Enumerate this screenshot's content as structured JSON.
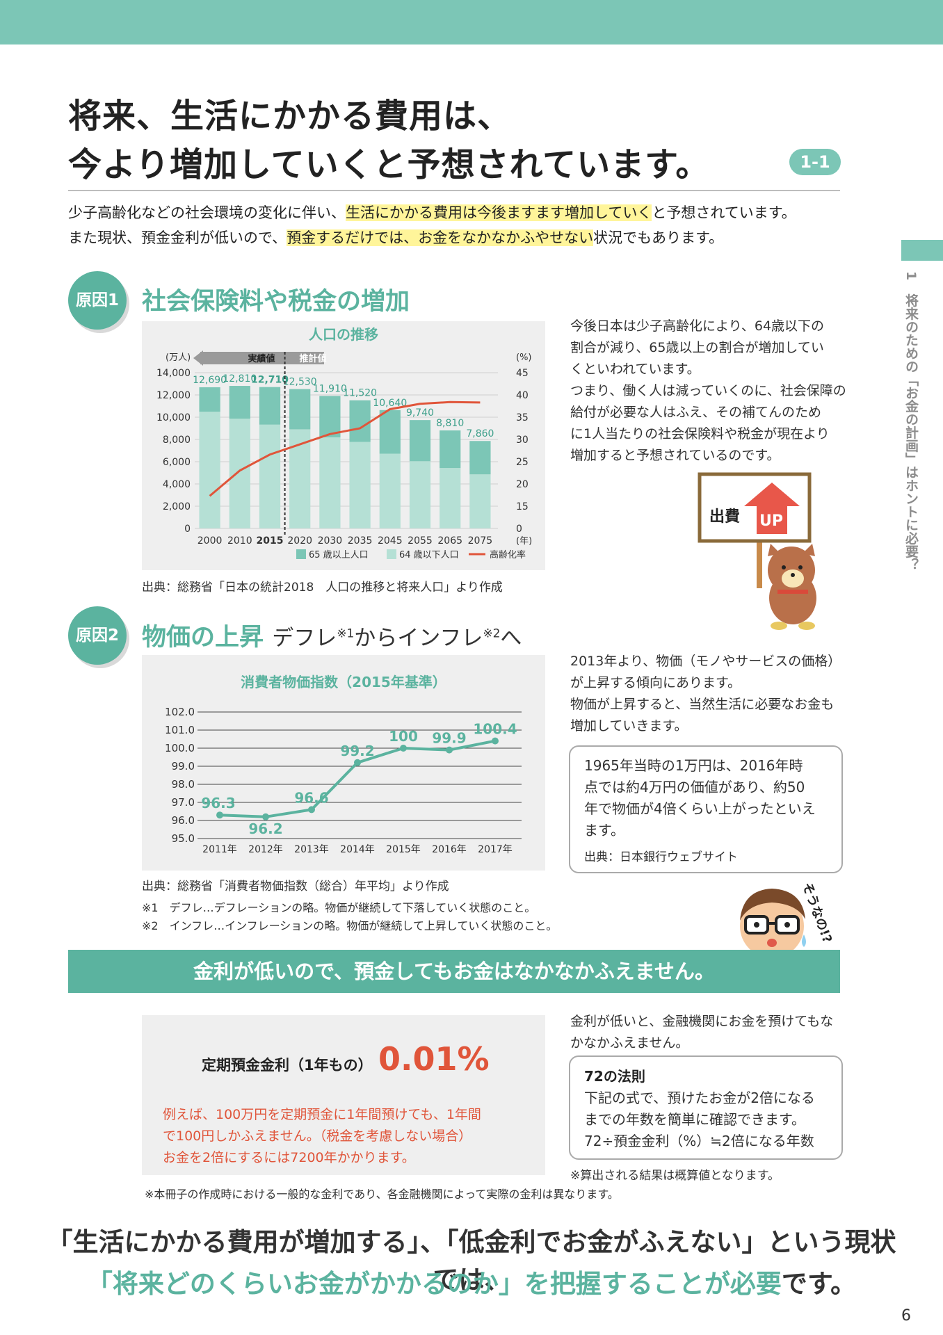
{
  "header": {
    "title_line1": "将来、生活にかかる費用は、",
    "title_line2": "今より増加していくと予想されています。",
    "badge": "1-1"
  },
  "side_tab": {
    "number": "1",
    "label": "将来のための「お金の計画」はホントに必要？"
  },
  "intro": {
    "l1a": "少子高齢化などの社会環境の変化に伴い、",
    "l1b": "生活にかかる費用は今後ますます増加していく",
    "l1c": "と予想されています。",
    "l2a": "また現状、預金金利が低いので、",
    "l2b": "預金するだけでは、お金をなかなかふやせない",
    "l2c": "状況でもあります。"
  },
  "cause1": {
    "badge": "原因1",
    "title": "社会保険料や税金の増加",
    "para": [
      "今後日本は少子高齢化により、64歳以下の",
      "割合が減り、65歳以上の割合が増加してい",
      "くといわれています。",
      "つまり、働く人は減っていくのに、社会保障の",
      "給付が必要な人はふえ、その補てんのため",
      "に1人当たりの社会保険料や税金が現在より",
      "増加すると予想されているのです。"
    ],
    "sign_text": "出費",
    "sign_up": "UP",
    "source": "出典：総務省「日本の統計2018　人口の推移と将来人口」より作成"
  },
  "cause2": {
    "badge": "原因2",
    "title": "物価の上昇",
    "subtitle_a": "デフレ",
    "subtitle_sup1": "※1",
    "subtitle_b": "からインフレ",
    "subtitle_sup2": "※2",
    "subtitle_c": "へ",
    "para": [
      "2013年より、物価（モノやサービスの価格）",
      "が上昇する傾向にあります。",
      "物価が上昇すると、当然生活に必要なお金も",
      "増加していきます。"
    ],
    "box": [
      "1965年当時の1万円は、2016年時",
      "点では約4万円の価値があり、約50",
      "年で物価が4倍くらい上がったといえ",
      "ます。"
    ],
    "box_source": "出典：日本銀行ウェブサイト",
    "source": "出典：総務省「消費者物価指数（総合）年平均」より作成",
    "note1": "※1　デフレ…デフレーションの略。物価が継続して下落していく状態のこと。",
    "note2": "※2　インフレ…インフレーションの略。物価が継続して上昇していく状態のこと。",
    "speech": "そうなの!?"
  },
  "banner": "金利が低いので、預金してもお金はなかなかふえません。",
  "rate": {
    "label": "定期預金金利（1年もの）",
    "value": "0.01%",
    "example": [
      "例えば、100万円を定期預金に1年間預けても、1年間",
      "で100円しかふえません。（税金を考慮しない場合）",
      "お金を2倍にするには7200年かかります。"
    ],
    "footnote": "※本冊子の作成時における一般的な金利であり、各金融機関によって実際の金利は異なります。",
    "right_para": [
      "金利が低いと、金融機関にお金を預けてもな",
      "かなかふえません。"
    ],
    "rule_title": "72の法則",
    "rule_lines": [
      "下記の式で、預けたお金が2倍になる",
      "までの年数を簡単に確認できます。",
      "72÷預金金利（%）≒2倍になる年数"
    ],
    "rule_note": "※算出される結果は概算値となります。"
  },
  "conclusion": {
    "line1": "「生活にかかる費用が増加する」、「低金利でお金がふえない」という現状では、",
    "line2a": "「将来どのくらいお金がかかるのか」を把握することが必要",
    "line2b": "です。"
  },
  "page_number": "6",
  "colors": {
    "teal": "#7cc6b6",
    "teal_dark": "#5bb39f",
    "bar_light": "#b5e0d5",
    "line_red": "#e0553a",
    "highlight": "#fff59a"
  },
  "chart_data": [
    {
      "type": "bar",
      "title": "人口の推移",
      "ylabel_left": "(万人)",
      "ylabel_right": "(%)",
      "xlabel": "(年)",
      "header_actual": "実績値",
      "header_forecast": "推計値",
      "categories": [
        "2000",
        "2010",
        "2015",
        "2020",
        "2030",
        "2035",
        "2045",
        "2055",
        "2065",
        "2075"
      ],
      "totals": [
        "12,690",
        "12,810",
        "12,710",
        "12,530",
        "11,910",
        "11,520",
        "10,640",
        "9,740",
        "8,810",
        "7,860"
      ],
      "series": [
        {
          "name": "65 歳以上人口",
          "values": [
            2200,
            2950,
            3380,
            3620,
            3720,
            3740,
            3920,
            3700,
            3380,
            3000
          ]
        },
        {
          "name": "64 歳以下人口",
          "values": [
            10490,
            9860,
            9330,
            8910,
            8190,
            7780,
            6720,
            6040,
            5430,
            4860
          ]
        },
        {
          "name": "高齢化率",
          "values": [
            17.3,
            23.0,
            26.6,
            28.9,
            31.2,
            32.5,
            36.8,
            38.0,
            38.4,
            38.3
          ]
        }
      ],
      "ylim": [
        0,
        14000
      ],
      "yticks": [
        "0",
        "2,000",
        "4,000",
        "6,000",
        "8,000",
        "10,000",
        "12,000",
        "14,000"
      ],
      "y2ticks": [
        "0",
        "15",
        "20",
        "25",
        "30",
        "35",
        "40",
        "45"
      ],
      "y2lim": [
        10,
        45
      ]
    },
    {
      "type": "line",
      "title": "消費者物価指数（2015年基準）",
      "categories": [
        "2011年",
        "2012年",
        "2013年",
        "2014年",
        "2015年",
        "2016年",
        "2017年"
      ],
      "values": [
        96.3,
        96.2,
        96.6,
        99.2,
        100,
        99.9,
        100.4
      ],
      "labels": [
        "96.3",
        "96.2",
        "96.6",
        "99.2",
        "100",
        "99.9",
        "100.4"
      ],
      "ylim": [
        95.0,
        102.0
      ],
      "yticks": [
        "95.0",
        "96.0",
        "97.0",
        "98.0",
        "99.0",
        "100.0",
        "101.0",
        "102.0"
      ]
    }
  ]
}
